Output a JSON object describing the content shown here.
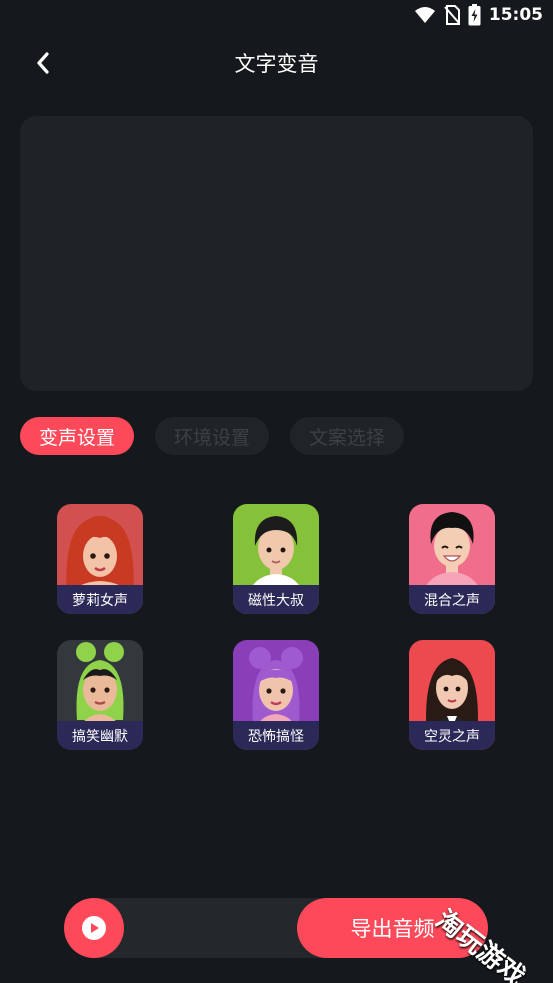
{
  "status_bar": {
    "time": "15:05",
    "icons": [
      "wifi-icon",
      "no-sim-icon",
      "battery-charging-icon"
    ]
  },
  "header": {
    "back_icon": "chevron-left-icon",
    "title": "文字变音"
  },
  "text_input": {
    "value": "",
    "placeholder": ""
  },
  "tabs": [
    {
      "label": "变声设置",
      "active": true
    },
    {
      "label": "环境设置",
      "active": false
    },
    {
      "label": "文案选择",
      "active": false
    }
  ],
  "voices": [
    {
      "label": "萝莉女声",
      "bg": "#d2504f",
      "hair": "#c93a22"
    },
    {
      "label": "磁性大叔",
      "bg": "#86c13a",
      "hair": "#1c1c1c"
    },
    {
      "label": "混合之声",
      "bg": "#f06d8c",
      "hair": "#111111"
    },
    {
      "label": "搞笑幽默",
      "bg": "#33383c",
      "hair": "#8fd34a"
    },
    {
      "label": "恐怖搞怪",
      "bg": "#8a3fb8",
      "hair": "#a05ad0"
    },
    {
      "label": "空灵之声",
      "bg": "#ec4a4f",
      "hair": "#2a1a16"
    }
  ],
  "bottom": {
    "play_icon": "play-icon",
    "export_label": "导出音频"
  },
  "watermark": "淘玩游戏",
  "colors": {
    "accent": "#fd4959",
    "background": "#15181c",
    "panel": "#1f2226",
    "label_band": "#2b2958"
  }
}
